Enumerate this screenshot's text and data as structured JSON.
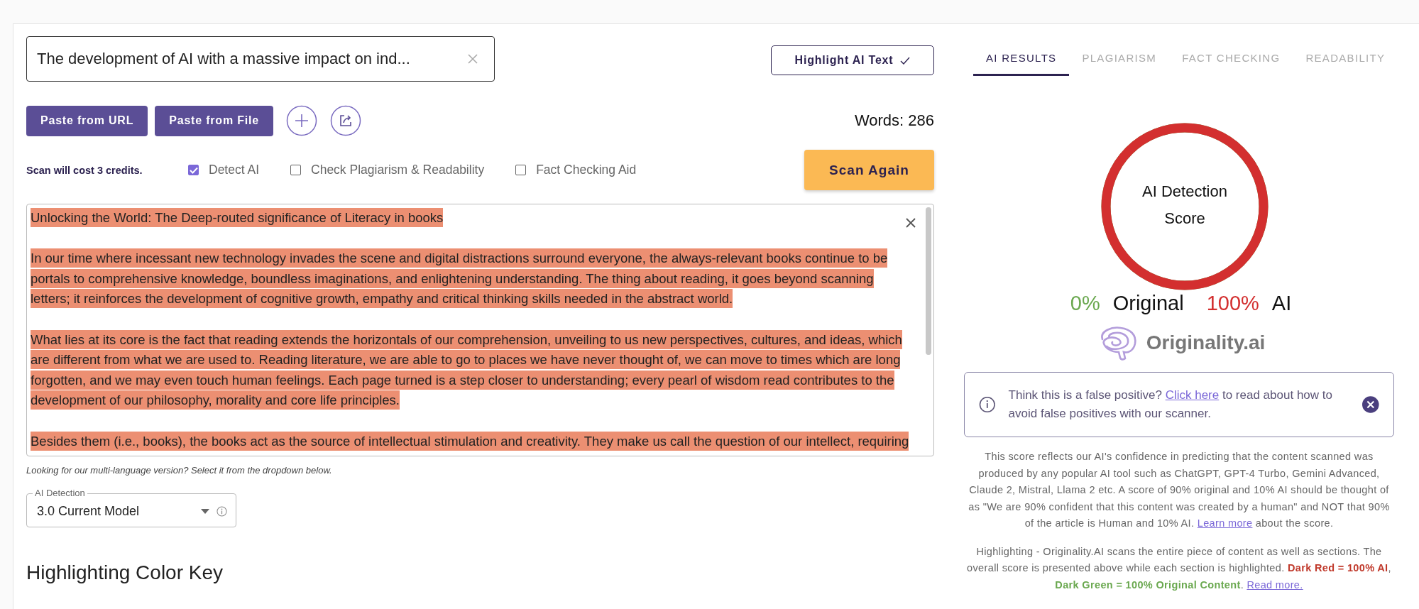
{
  "search_field": {
    "value": "The development of AI with a massive impact on ind..."
  },
  "highlight_button": {
    "label": "Highlight AI Text",
    "on": true
  },
  "paste_buttons": [
    {
      "label": "Paste from URL"
    },
    {
      "label": "Paste from File"
    }
  ],
  "word_count": "Words: 286",
  "scan_cost": "Scan will cost 3 credits.",
  "options": [
    {
      "label": "Detect AI",
      "checked": true
    },
    {
      "label": "Check Plagiarism & Readability",
      "checked": false
    },
    {
      "label": "Fact Checking Aid",
      "checked": false
    }
  ],
  "scan_button": {
    "label": "Scan Again"
  },
  "content": {
    "paragraphs": [
      {
        "color": "#ec8f72",
        "lines": [
          "Unlocking the World: The Deep-routed significance of Literacy in books"
        ]
      },
      {
        "color": "#ec8f72",
        "lines": [
          "In our time where incessant new technology invades the scene and digital distractions surround everyone, the always-relevant books continue to be",
          "portals to comprehensive knowledge, boundless imaginations, and enlightening understanding. The thing about reading, it goes beyond scanning",
          "letters; it reinforces the development of cognitive growth, empathy and critical thinking skills needed in the abstract world."
        ]
      },
      {
        "color": "#ec8f72",
        "lines": [
          "What lies at its core is the fact that reading extends the horizontals of our comprehension, unveiling to us new perspectives, cultures, and ideas, which",
          "are different from what we are used to. Reading literature, we are able to go to places we have never thought of, we can move to times which are long",
          "forgotten, and we may even touch human feelings. Each page turned is a step closer to understanding; every pearl of wisdom read contributes to the",
          "development of our philosophy, morality and core life principles."
        ]
      },
      {
        "color": "#ec8f72",
        "lines": [
          "Besides them (i.e., books), the books act as the source of intellectual stimulation and creativity. They make us call the question of our intellect, requiring"
        ]
      }
    ]
  },
  "multilanguage_note": "Looking for our multi-language version? Select it from the dropdown below.",
  "model_select": {
    "label": "AI Detection",
    "value": "3.0 Current Model"
  },
  "color_key_heading": "Highlighting Color Key",
  "tabs": [
    {
      "label": "AI RESULTS",
      "selected": true
    },
    {
      "label": "PLAGIARISM",
      "selected": false
    },
    {
      "label": "FACT CHECKING",
      "selected": false
    },
    {
      "label": "READABILITY",
      "selected": false
    }
  ],
  "score": {
    "title": "AI Detection Score",
    "level": 1,
    "original_percent": "0%",
    "original_label": "Original",
    "ai_percent": "100%",
    "ai_label": "AI"
  },
  "logo": {
    "text": "Originality.ai"
  },
  "notice": {
    "segments": [
      {
        "kind": "text",
        "text": "Think this is a false positive? "
      },
      {
        "kind": "link",
        "text": "Click here"
      },
      {
        "kind": "text",
        "text": " to read about how to avoid false positives with our scanner."
      }
    ]
  },
  "explanations": [
    {
      "segments": [
        {
          "kind": "text",
          "text": "This score reflects our AI's confidence in predicting that the content scanned was produced by any popular AI tool such as ChatGPT, GPT-4 Turbo, Gemini Advanced, Claude 2, Mistral, Llama 2 etc. A score of 90% original and 10% AI should be thought of as \"We are 90% confident that this content was created by a human\" and NOT that 90% of the article is Human and 10% AI. "
        },
        {
          "kind": "link",
          "text": "Learn more"
        },
        {
          "kind": "text",
          "text": " about the score."
        }
      ]
    },
    {
      "segments": [
        {
          "kind": "text",
          "text": "Highlighting - Originality.AI scans the entire piece of content as well as sections. The overall score is presented above while each section is highlighted. "
        },
        {
          "kind": "ai_key",
          "text": "Dark Red = 100% AI"
        },
        {
          "kind": "text",
          "text": ", "
        },
        {
          "kind": "original_key",
          "text": "Dark Green = 100% Original Content"
        },
        {
          "kind": "text",
          "text": ". "
        },
        {
          "kind": "link",
          "text": "Read more."
        }
      ]
    }
  ]
}
